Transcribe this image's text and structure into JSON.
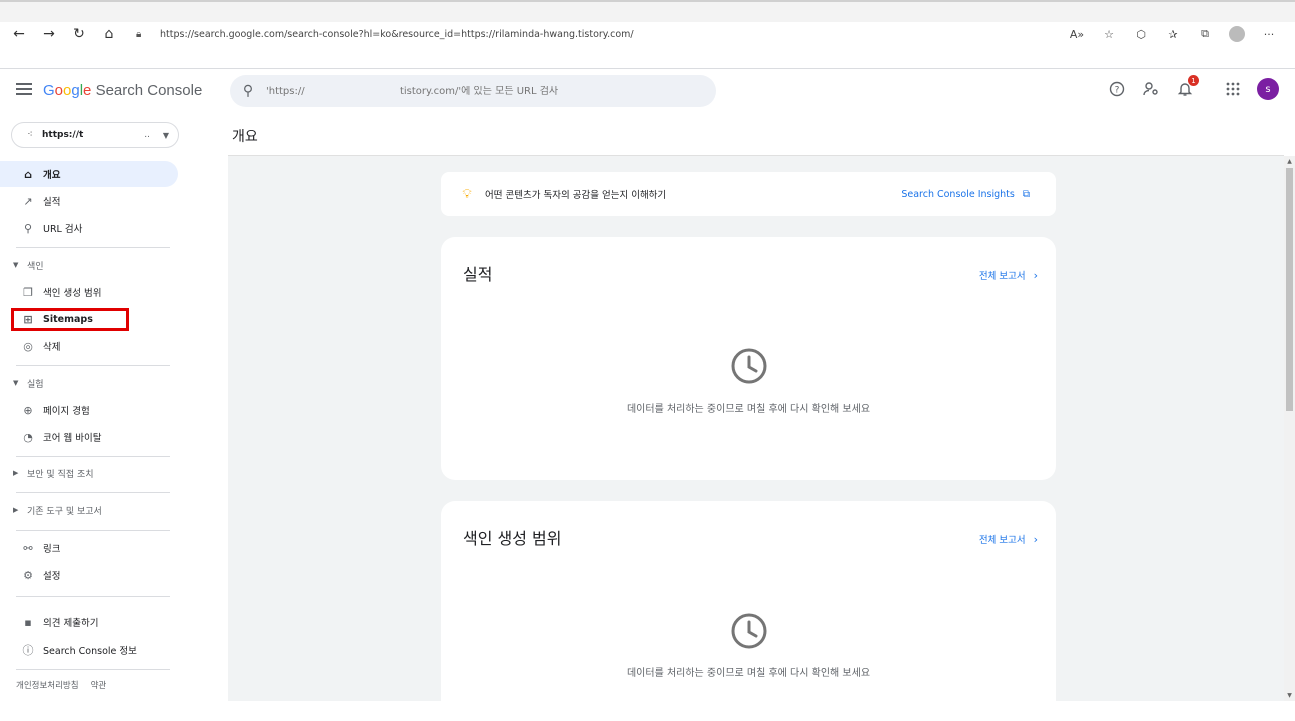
{
  "browser": {
    "url": "https://search.google.com/search-console?hl=ko&resource_id=https://rilaminda-hwang.tistory.com/",
    "icons": [
      "back-icon",
      "forward-icon",
      "refresh-icon",
      "home-icon",
      "lock-icon",
      "read-aloud-icon",
      "favorite-add-icon",
      "extensions-icon",
      "favorites-icon",
      "collections-icon",
      "profile-icon",
      "more-icon"
    ]
  },
  "header": {
    "logo_google": [
      "G",
      "o",
      "o",
      "g",
      "l",
      "e"
    ],
    "logo_product": "Search Console",
    "search_placeholder": "'https://                              tistory.com/'에 있는 모든 URL 검사",
    "notification_count": "1",
    "user_initial": "s"
  },
  "sidebar": {
    "property": "https://t",
    "property_suffix": "..",
    "items": {
      "overview": "개요",
      "performance": "실적",
      "url_inspection": "URL 검사",
      "index_section": "색인",
      "coverage": "색인 생성 범위",
      "sitemaps": "Sitemaps",
      "removals": "삭제",
      "experience_section": "실험",
      "page_experience": "페이지 경험",
      "core_web_vitals": "코어 웹 바이탈",
      "security_section": "보안 및 직접 조치",
      "legacy_section": "기존 도구 및 보고서",
      "links": "링크",
      "settings": "설정",
      "feedback": "의견 제출하기",
      "about": "Search Console 정보"
    },
    "footer": {
      "privacy": "개인정보처리방침",
      "terms": "약관"
    }
  },
  "main": {
    "page_title": "개요",
    "insight": {
      "text": "어떤 콘텐츠가 독자의 공감을 얻는지 이해하기",
      "link": "Search Console Insights"
    },
    "cards": [
      {
        "title": "실적",
        "link": "전체 보고서",
        "message": "데이터를 처리하는 중이므로 며칠 후에 다시 확인해 보세요"
      },
      {
        "title": "색인 생성 범위",
        "link": "전체 보고서",
        "message": "데이터를 처리하는 중이므로 며칠 후에 다시 확인해 보세요"
      }
    ]
  },
  "colors": {
    "accent": "#1a73e8",
    "active_nav": "#e8f0fe",
    "highlight": "#e00000",
    "avatar": "#7b1fa2"
  }
}
